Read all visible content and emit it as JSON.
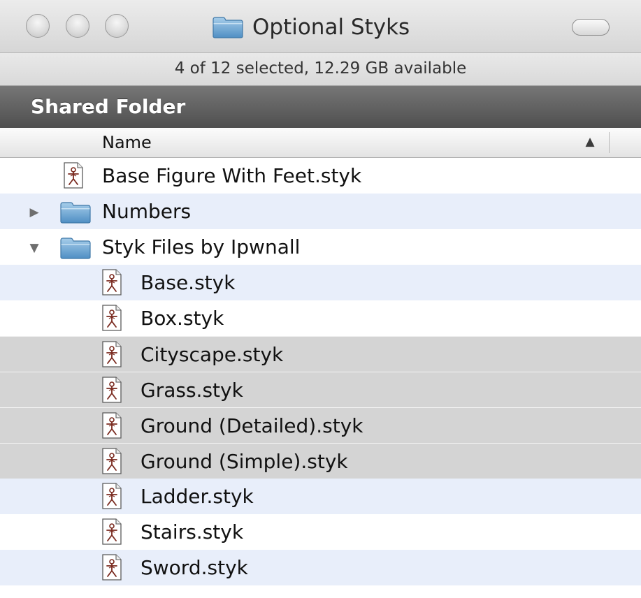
{
  "window": {
    "title": "Optional Styks",
    "status": "4 of 12 selected, 12.29 GB available",
    "shared_label": "Shared Folder"
  },
  "columns": {
    "name_header": "Name",
    "sort": "ascending"
  },
  "colors": {
    "selection": "#d4d4d4",
    "stripe": "#e8eefa",
    "shared_bar": "#5f5f5f",
    "folder_blue": "#6ba8d8"
  },
  "rows": [
    {
      "label": "Base Figure With Feet.styk",
      "kind": "file",
      "level": 0,
      "selected": false
    },
    {
      "label": "Numbers",
      "kind": "folder",
      "level": 0,
      "expanded": false,
      "selected": false
    },
    {
      "label": "Styk Files by Ipwnall",
      "kind": "folder",
      "level": 0,
      "expanded": true,
      "selected": false
    },
    {
      "label": "Base.styk",
      "kind": "file",
      "level": 1,
      "selected": false
    },
    {
      "label": "Box.styk",
      "kind": "file",
      "level": 1,
      "selected": false
    },
    {
      "label": "Cityscape.styk",
      "kind": "file",
      "level": 1,
      "selected": true
    },
    {
      "label": "Grass.styk",
      "kind": "file",
      "level": 1,
      "selected": true
    },
    {
      "label": "Ground (Detailed).styk",
      "kind": "file",
      "level": 1,
      "selected": true
    },
    {
      "label": "Ground (Simple).styk",
      "kind": "file",
      "level": 1,
      "selected": true
    },
    {
      "label": "Ladder.styk",
      "kind": "file",
      "level": 1,
      "selected": false
    },
    {
      "label": "Stairs.styk",
      "kind": "file",
      "level": 1,
      "selected": false
    },
    {
      "label": "Sword.styk",
      "kind": "file",
      "level": 1,
      "selected": false
    }
  ]
}
